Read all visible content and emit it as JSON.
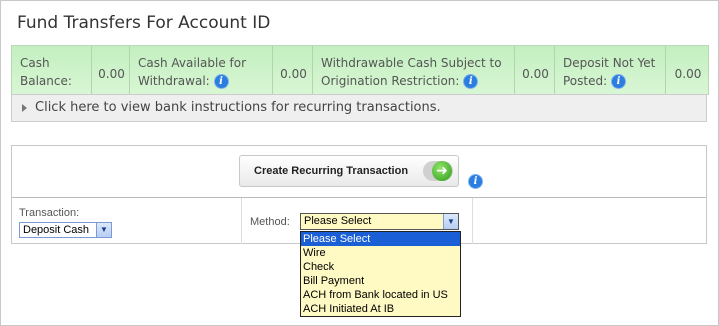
{
  "title": "Fund Transfers For Account ID",
  "balances": [
    {
      "label": "Cash Balance:",
      "value": "0.00",
      "has_info": false
    },
    {
      "label": "Cash Available for Withdrawal:",
      "value": "0.00",
      "has_info": true
    },
    {
      "label": "Withdrawable Cash Subject to Origination Restriction:",
      "value": "0.00",
      "has_info": true
    },
    {
      "label": "Deposit Not Yet Posted:",
      "value": "0.00",
      "has_info": true
    }
  ],
  "instructions_link": "Click here to view bank instructions for recurring transactions.",
  "create_button": "Create Recurring Transaction",
  "transaction": {
    "label": "Transaction:",
    "selected": "Deposit Cash"
  },
  "method": {
    "label": "Method:",
    "selected": "Please Select",
    "options": [
      "Please Select",
      "Wire",
      "Check",
      "Bill Payment",
      "ACH from Bank located in US",
      "ACH Initiated At IB"
    ],
    "highlighted_index": 0
  },
  "colors": {
    "balance_bg": "#c3efc0",
    "info_icon": "#2b7de0",
    "dropdown_bg": "#fff9c4",
    "highlight": "#1a5fd6"
  }
}
